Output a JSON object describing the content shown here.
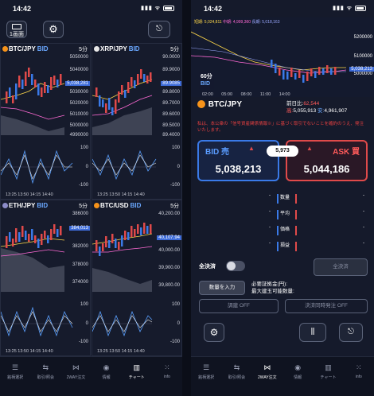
{
  "colors": {
    "bg": "#151a2b",
    "bid": "#3a7ae8",
    "ask": "#e04a4a",
    "candle_up": "#e04a4a",
    "candle_down": "#3a7ae8"
  },
  "status": {
    "time": "14:42"
  },
  "left": {
    "toolbar": {
      "one_screen_label": "1画面",
      "settings_icon": "gear-icon",
      "layout_icon": "layout-toggle-icon"
    },
    "cells": [
      {
        "symbol": "BTC/JPY",
        "side": "BID",
        "tf": "5分",
        "yticks": [
          "5050000",
          "5040000",
          "",
          "5030000",
          "5020000",
          "5010000",
          "5000000",
          "4990000",
          "100",
          "0",
          "-100"
        ],
        "price": "5,038,281",
        "xticks": "13:25 13:50 14:15 14:40"
      },
      {
        "symbol": "XRP/JPY",
        "side": "BID",
        "tf": "5分",
        "yticks": [
          "90.0000",
          "89.9000",
          "",
          "89.8000",
          "89.7000",
          "89.6000",
          "89.5000",
          "89.4000",
          "100",
          "0",
          "-100"
        ],
        "price": "89.9085",
        "xticks": "13:25 13:50 14:15 14:40"
      },
      {
        "symbol": "ETH/JPY",
        "side": "BID",
        "tf": "5分",
        "yticks": [
          "386000",
          "",
          "382000",
          "378000",
          "374000",
          "100",
          "0",
          "-100"
        ],
        "price": "384,013",
        "xticks": "13:25 13:50 14:15 14:40"
      },
      {
        "symbol": "BTC/USD",
        "side": "BID",
        "tf": "5分",
        "yticks": [
          "40,200.00",
          "",
          "40,000.00",
          "39,900.00",
          "39,800.00",
          "100",
          "0",
          "-100"
        ],
        "price": "40,107.94",
        "xticks": "13:25 13:50 14:15 14:40"
      }
    ],
    "tabs": [
      {
        "icon": "list-icon",
        "label": "銘柄選択"
      },
      {
        "icon": "history-icon",
        "label": "取引/照会"
      },
      {
        "icon": "dual-order-icon",
        "label": "2WAY注文"
      },
      {
        "icon": "info-circle-icon",
        "label": "情報"
      },
      {
        "icon": "chart-icon",
        "label": "チャート"
      },
      {
        "icon": "grid-icon",
        "label": "info"
      }
    ]
  },
  "right": {
    "mini_chart": {
      "ma_short": "短期: 5,024,811",
      "ma_mid": "中期: 4,999,360",
      "ma_long": "長期: 5,018,163",
      "yticks": [
        "5200000",
        "5100000",
        "5000000"
      ],
      "price": "5,038,213",
      "xticks": "02:00 05:00 08:00 11:00 14:00",
      "tf": "60分",
      "side": "BID"
    },
    "symbol": "BTC/JPY",
    "stats": {
      "prev_close_label": "前日比:",
      "prev_close_val": "62,544",
      "high_label": "高:",
      "high_val": "5,055,913",
      "low_label": "安:",
      "low_val": "4,961,907"
    },
    "notice": "私は、本公衆の「信号資産関係情報※」に基づく取引でないことを確約のうえ、発注いたします。",
    "bid": {
      "label": "BID 売",
      "value": "5,038,213"
    },
    "ask": {
      "label": "ASK 買",
      "value": "5,044,186"
    },
    "spread": "5,973",
    "order_rows": [
      "数量",
      "平均",
      "価格",
      "損益"
    ],
    "close_all_toggle": "全決済",
    "close_all_button": "全決済",
    "qty_button": "数量を入力",
    "margin_label": "必要証拠金(円):",
    "max_qty_label": "最大建玉可能数量:",
    "stop_order_button": "調建 OFF",
    "close_order_button": "決済同時発注 OFF",
    "tabs": [
      {
        "icon": "list-icon",
        "label": "銘柄選択"
      },
      {
        "icon": "history-icon",
        "label": "取引/照会"
      },
      {
        "icon": "dual-order-icon",
        "label": "2WAY注文"
      },
      {
        "icon": "info-circle-icon",
        "label": "情報"
      },
      {
        "icon": "chart-icon",
        "label": "チャート"
      },
      {
        "icon": "grid-icon",
        "label": "info"
      }
    ]
  }
}
